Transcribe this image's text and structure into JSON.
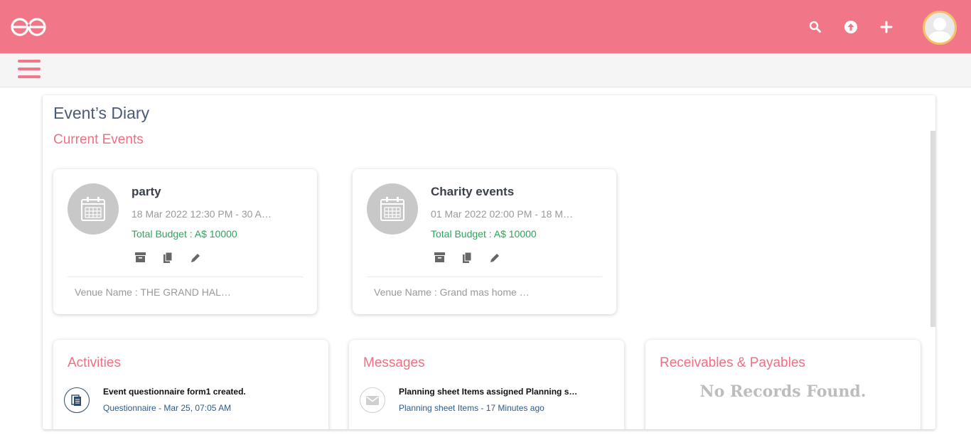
{
  "header": {
    "logo": "logo-icon",
    "icons": [
      "search-icon",
      "upload-icon",
      "plus-icon",
      "avatar"
    ],
    "brand_color": "#f17788"
  },
  "main": {
    "page_title": "Event’s Diary",
    "section_title": "Current Events",
    "events": [
      {
        "name": "party",
        "dates": "18 Mar 2022 12:30 PM - 30 A…",
        "budget": "Total Budget : A$ 10000",
        "venue": "Venue Name : THE GRAND HAL…"
      },
      {
        "name": "Charity events",
        "dates": "01 Mar 2022 02:00 PM - 18 M…",
        "budget": "Total Budget : A$ 10000",
        "venue": "Venue Name : Grand mas home …"
      }
    ],
    "activities": {
      "title": "Activities",
      "item_text": "Event questionnaire form1 ",
      "item_strong": "created.",
      "item_sub": "Questionnaire - Mar 25, 07:05 AM"
    },
    "messages": {
      "title": "Messages",
      "item_text": "Planning sheet Items assigned Planning s…",
      "item_sub": "Planning sheet Items - 17 Minutes ago"
    },
    "receivables": {
      "title": "Receivables & Payables",
      "empty": "No Records Found."
    }
  }
}
